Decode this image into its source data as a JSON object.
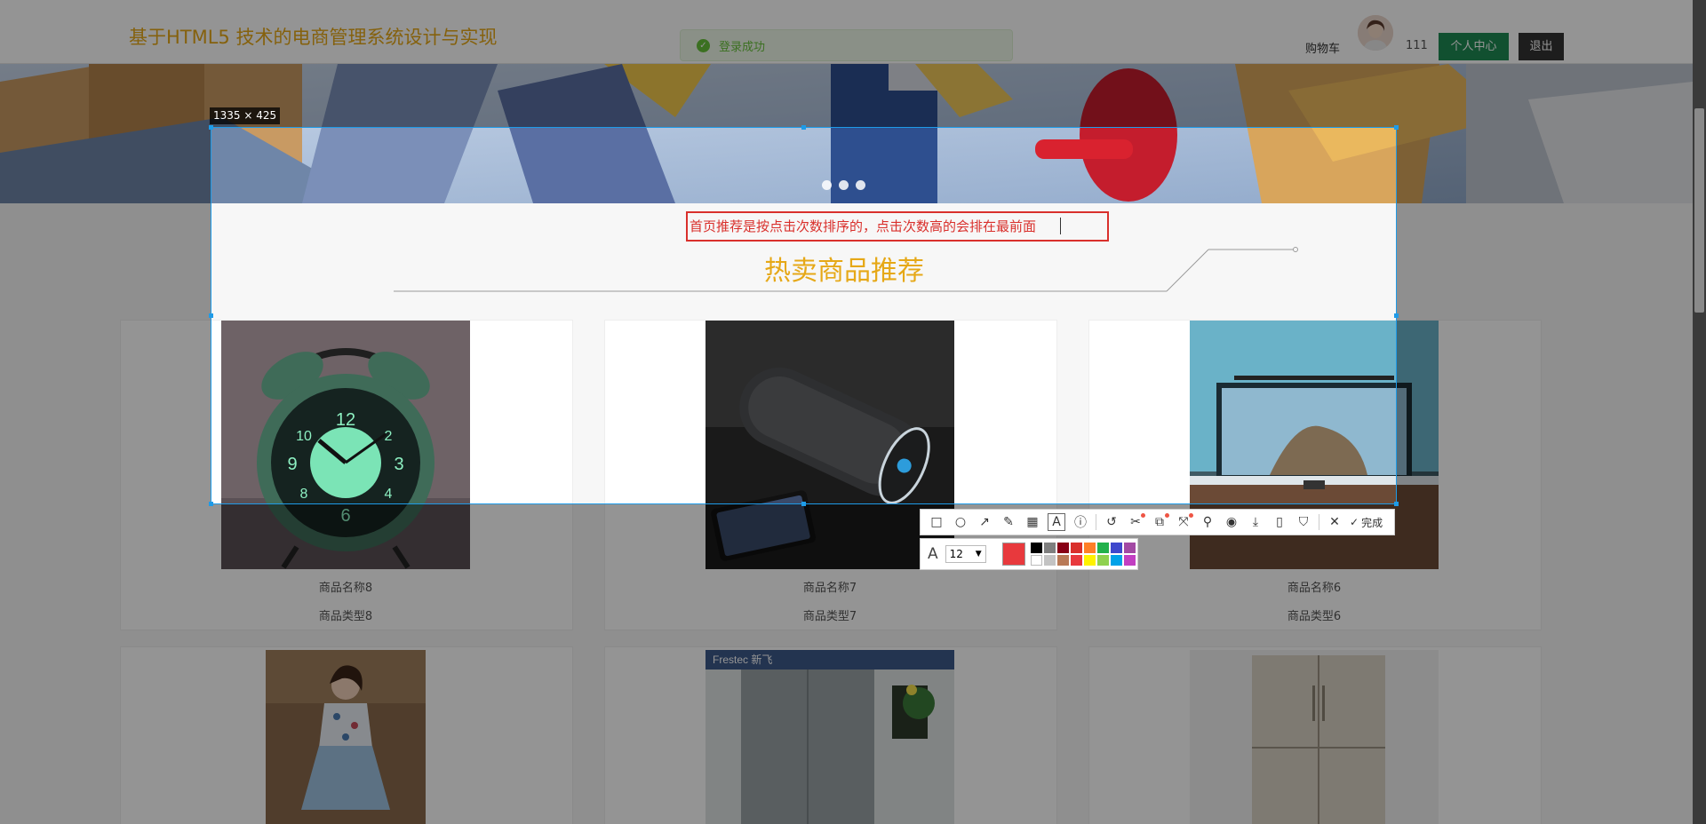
{
  "header": {
    "site_title": "基于HTML5 技术的电商管理系统设计与实现",
    "toast_text": "登录成功",
    "cart_label": "购物车",
    "username": "111",
    "user_center_label": "个人中心",
    "logout_label": "退出"
  },
  "banner": {
    "slide_count": 3
  },
  "hot_section": {
    "title": "热卖商品推荐"
  },
  "products": [
    {
      "name": "商品名称8",
      "type": "商品类型8",
      "image": "alarm-clock"
    },
    {
      "name": "商品名称7",
      "type": "商品类型7",
      "image": "bluetooth-speaker"
    },
    {
      "name": "商品名称6",
      "type": "商品类型6",
      "image": "desk-monitor"
    },
    {
      "name": "",
      "type": "",
      "image": "dress"
    },
    {
      "name": "",
      "type": "",
      "image": "refrigerator-frestec"
    },
    {
      "name": "",
      "type": "",
      "image": "refrigerator-french-door"
    }
  ],
  "screenshot_tool": {
    "selection_size": "1335 × 425",
    "annotation_text": "首页推荐是按点击次数排序的，点击次数高的会排在最前面",
    "done_label": "完成",
    "font_size": "12",
    "current_color": "#e8393d",
    "tools": [
      "rectangle-icon",
      "ellipse-icon",
      "arrow-icon",
      "pencil-icon",
      "mosaic-icon",
      "text-icon",
      "serial-number-icon",
      "undo-icon",
      "ocr-icon",
      "translate-icon",
      "scroll-capture-icon",
      "pin-icon",
      "record-icon",
      "download-icon",
      "phone-icon",
      "bookmark-icon",
      "close-icon"
    ],
    "palette": [
      "#000000",
      "#7f7f7f",
      "#880015",
      "#d9302c",
      "#ff7f27",
      "#22b14c",
      "#3f48cc",
      "#a349a4",
      "#ffffff",
      "#c3c3c3",
      "#b97a57",
      "#e8393d",
      "#fff200",
      "#8fd14f",
      "#00a2e8",
      "#c23fc2"
    ]
  },
  "colors": {
    "accent": "#e6a817",
    "primary_green": "#1e8a53",
    "annotation_red": "#d9302c",
    "selection_blue": "#1e9be8"
  }
}
